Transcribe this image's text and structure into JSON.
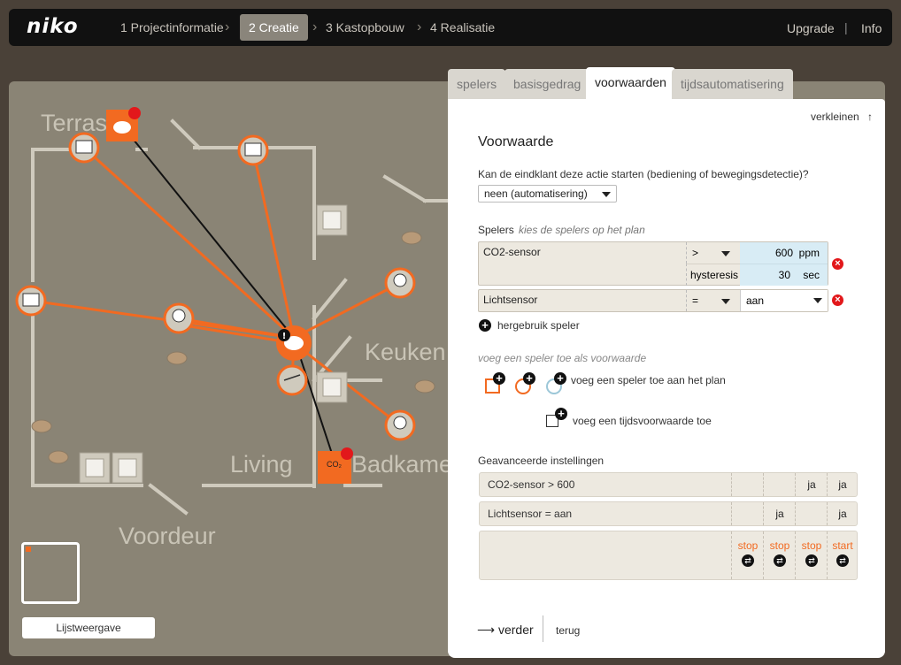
{
  "brand": "niko",
  "steps": [
    "1 Projectinformatie",
    "2 Creatie",
    "3 Kastopbouw",
    "4 Realisatie"
  ],
  "top_links": {
    "upgrade": "Upgrade",
    "sep": "|",
    "info": "Info"
  },
  "plan": {
    "rooms": [
      "Terras",
      "Keuken",
      "Living",
      "Badkamer",
      "Voordeur"
    ],
    "list_view_button": "Lijstweergave",
    "co2_label": "CO₂"
  },
  "tabs": [
    "spelers",
    "basisgedrag",
    "voorwaarden",
    "tijdsautomatisering"
  ],
  "panel": {
    "shrink": "verkleinen",
    "shrink_icon": "↑",
    "title": "Voorwaarde",
    "question": "Kan de eindklant deze actie starten (bediening of bewegingsdetectie)?",
    "question_value": "neen (automatisering)",
    "players_label": "Spelers",
    "players_hint": "kies de spelers op het plan",
    "players": [
      {
        "name": "CO2-sensor",
        "operator": ">",
        "value": "600",
        "unit": "ppm",
        "extra_label": "hysteresis",
        "extra_value": "30",
        "extra_unit": "sec"
      },
      {
        "name": "Lichtsensor",
        "operator": "=",
        "value": "aan"
      }
    ],
    "reuse": "hergebruik speler",
    "add_hint": "voeg een speler toe als voorwaarde",
    "add_plan": "voeg een speler toe aan het plan",
    "add_time": "voeg een tijdsvoorwaarde toe",
    "advanced_title": "Geavanceerde instellingen",
    "advanced_rows": [
      {
        "label": "CO2-sensor > 600",
        "cols": [
          "",
          "",
          "ja",
          "ja"
        ]
      },
      {
        "label": "Lichtsensor = aan",
        "cols": [
          "",
          "ja",
          "",
          "ja"
        ]
      }
    ],
    "actions": [
      "stop",
      "stop",
      "stop",
      "start"
    ],
    "next": "verder",
    "back": "terug"
  },
  "colors": {
    "accent": "#f26a21",
    "plan_bg": "#8a8475",
    "danger": "#e2181b"
  }
}
